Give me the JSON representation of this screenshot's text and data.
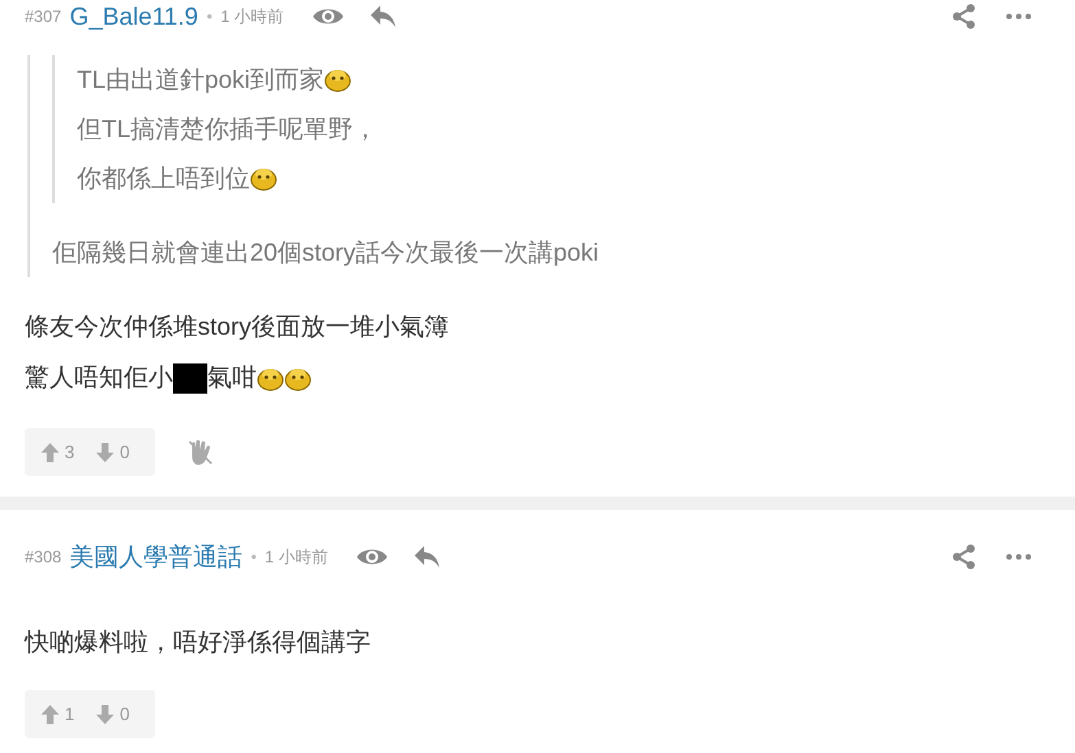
{
  "posts": [
    {
      "number": "#307",
      "username": "G_Bale11.9",
      "separator": "•",
      "time": "1 小時前",
      "quote": {
        "quote": {
          "lines": [
            [
              {
                "kind": "text",
                "text": "TL由出道針poki到而家"
              },
              {
                "kind": "emoji"
              }
            ],
            [
              {
                "kind": "text",
                "text": "但TL搞清楚你插手呢單野，"
              }
            ],
            [
              {
                "kind": "text",
                "text": "你都係上唔到位"
              },
              {
                "kind": "emoji"
              }
            ]
          ]
        },
        "lines": [
          [
            {
              "kind": "text",
              "text": "佢隔幾日就會連出20個story話今次最後一次講poki"
            }
          ]
        ]
      },
      "body": [
        [
          {
            "kind": "text",
            "text": "條友今次仲係堆story後面放一堆小氣簿"
          }
        ],
        [
          {
            "kind": "text",
            "text": "驚人唔知佢小"
          },
          {
            "kind": "redacted"
          },
          {
            "kind": "text",
            "text": "氣咁"
          },
          {
            "kind": "emoji"
          },
          {
            "kind": "emoji"
          }
        ]
      ],
      "upvotes": "3",
      "downvotes": "0",
      "block_button": true
    },
    {
      "number": "#308",
      "username": "美國人學普通話",
      "separator": "•",
      "time": "1 小時前",
      "body": [
        [
          {
            "kind": "text",
            "text": "快啲爆料啦，唔好淨係得個講字"
          }
        ]
      ],
      "upvotes": "1",
      "downvotes": "0",
      "block_button": false
    }
  ]
}
